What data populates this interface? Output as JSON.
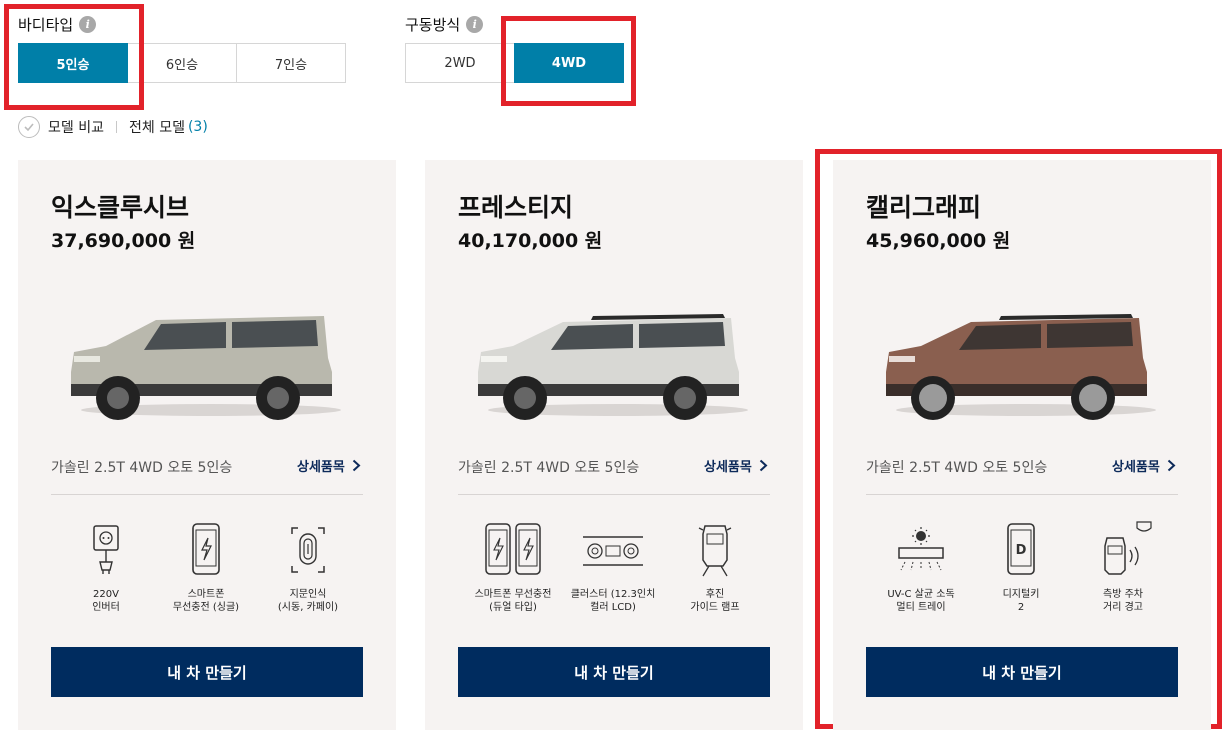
{
  "filters": {
    "body_type": {
      "label": "바디타입",
      "options": [
        "5인승",
        "6인승",
        "7인승"
      ],
      "selected": "5인승"
    },
    "drive_type": {
      "label": "구동방식",
      "options": [
        "2WD",
        "4WD"
      ],
      "selected": "4WD"
    }
  },
  "compare": {
    "label": "모델 비교",
    "all_models": "전체 모델",
    "count": "(3)"
  },
  "trims": [
    {
      "name": "익스클루시브",
      "price": "37,690,000 원",
      "spec": "가솔린 2.5T 4WD 오토 5인승",
      "detail_link": "상세품목",
      "car_color": "#b9b8ad",
      "features": [
        {
          "icon": "power-outlet-icon",
          "label": "220V\n인버터"
        },
        {
          "icon": "phone-charging-icon",
          "label": "스마트폰\n무선충전 (싱글)"
        },
        {
          "icon": "fingerprint-icon",
          "label": "지문인식\n(시동, 카페이)"
        }
      ],
      "build_button": "내 차 만들기"
    },
    {
      "name": "프레스티지",
      "price": "40,170,000 원",
      "spec": "가솔린 2.5T 4WD 오토 5인승",
      "detail_link": "상세품목",
      "car_color": "#d8d8d4",
      "features": [
        {
          "icon": "dual-phone-charging-icon",
          "label": "스마트폰 무선충전\n(듀얼 타입)"
        },
        {
          "icon": "cluster-display-icon",
          "label": "클러스터 (12.3인치\n컬러 LCD)"
        },
        {
          "icon": "rear-guide-lamp-icon",
          "label": "후진\n가이드 램프"
        }
      ],
      "build_button": "내 차 만들기"
    },
    {
      "name": "캘리그래피",
      "price": "45,960,000 원",
      "spec": "가솔린 2.5T 4WD 오토 5인승",
      "detail_link": "상세품목",
      "car_color": "#8a5f4f",
      "features": [
        {
          "icon": "uv-sterilizer-tray-icon",
          "label": "UV-C 살균 소독\n멀티 트레이"
        },
        {
          "icon": "digital-key-icon",
          "label": "디지털키\n2"
        },
        {
          "icon": "side-parking-warning-icon",
          "label": "측방 주차\n거리 경고"
        }
      ],
      "build_button": "내 차 만들기"
    }
  ],
  "colors": {
    "accent": "#007fa8",
    "navy": "#002c5f",
    "highlight": "#e2222a",
    "card_bg": "#f6f3f2"
  }
}
